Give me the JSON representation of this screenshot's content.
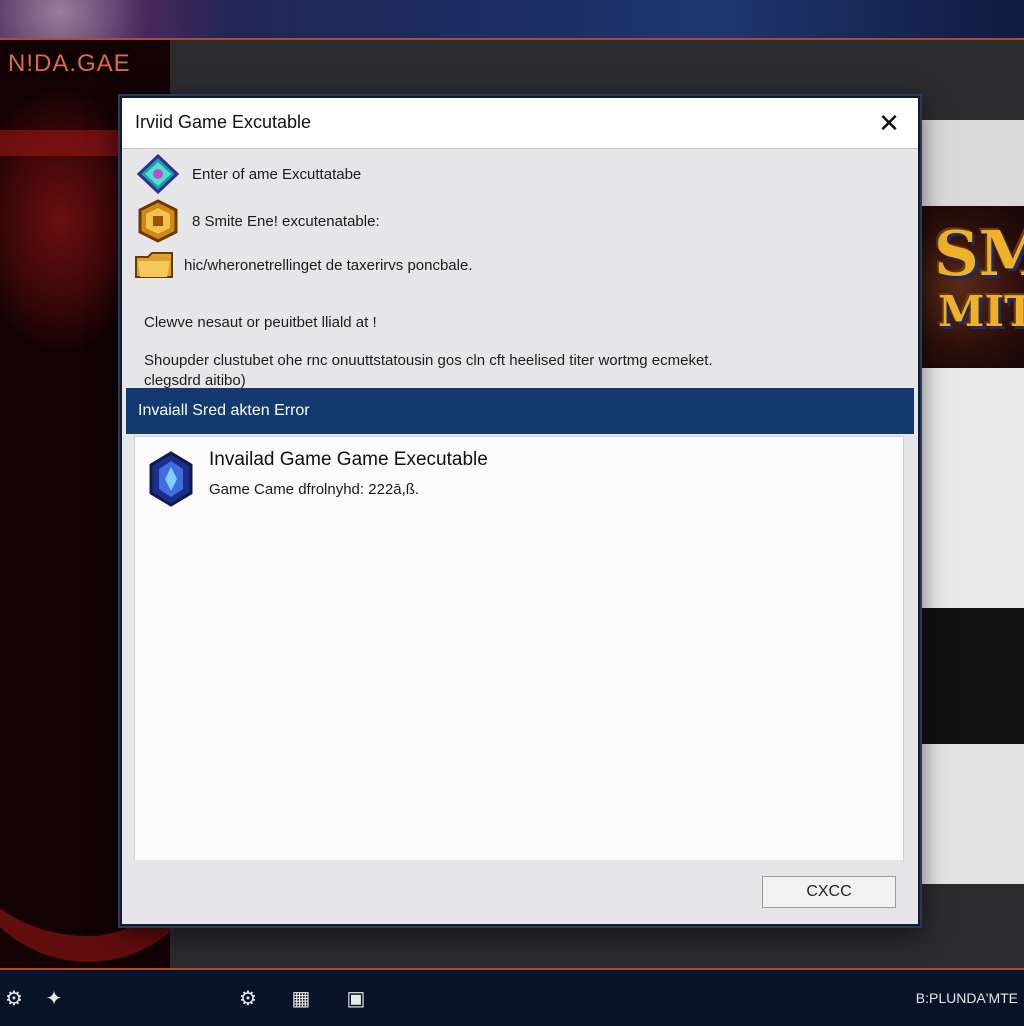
{
  "background_app": {
    "title": "N!DA.GAE",
    "logo_line1": "SM",
    "logo_line2": "MIT"
  },
  "dialog": {
    "title": "Irviid Game Excutable",
    "rows": [
      {
        "icon": "diamond-icon",
        "text": "Enter of ame Excuttatabe"
      },
      {
        "icon": "hex-badge-icon",
        "text": "8 Smite Ene! excutenatable:"
      },
      {
        "icon": "folder-icon",
        "text": "hic/wheronetrellinget de taxerirvs poncbale."
      }
    ],
    "message_line1": "Clewve nesaut or peuitbet lliald at !",
    "message_line2": "Shoupder clustubet ohe rnc onuuttstatousin gos cln cft heelised titer wortmg ecmeket.",
    "message_line3": "clegsdrd aitibo)",
    "error_header": "Invaiall Sred akten Error",
    "error_title": "Invailad Game Game Executable",
    "error_detail": "Game Came dfrolnyhd: 222ā,ß.",
    "cancel_label": "CXCC",
    "close_symbol": "✕"
  },
  "taskbar": {
    "label": "B:PLUNDA'MTE"
  },
  "colors": {
    "error_header_bg": "#123a70",
    "accent_orange": "#b04a2a"
  }
}
